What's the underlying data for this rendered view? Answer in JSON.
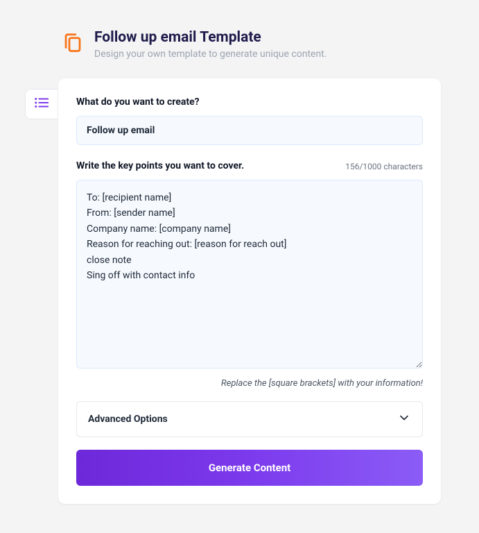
{
  "header": {
    "title": "Follow up email Template",
    "subtitle": "Design your own template to generate unique content."
  },
  "form": {
    "create_label": "What do you want to create?",
    "create_value": "Follow up email",
    "keypoints_label": "Write the key points you want to cover.",
    "char_count": "156/1000 characters",
    "keypoints_value": "To: [recipient name]\nFrom: [sender name]\nCompany name: [company name]\nReason for reaching out: [reason for reach out]\nclose note\nSing off with contact info",
    "hint": "Replace the [square brackets] with your information!",
    "advanced_label": "Advanced Options",
    "generate_label": "Generate Content"
  }
}
